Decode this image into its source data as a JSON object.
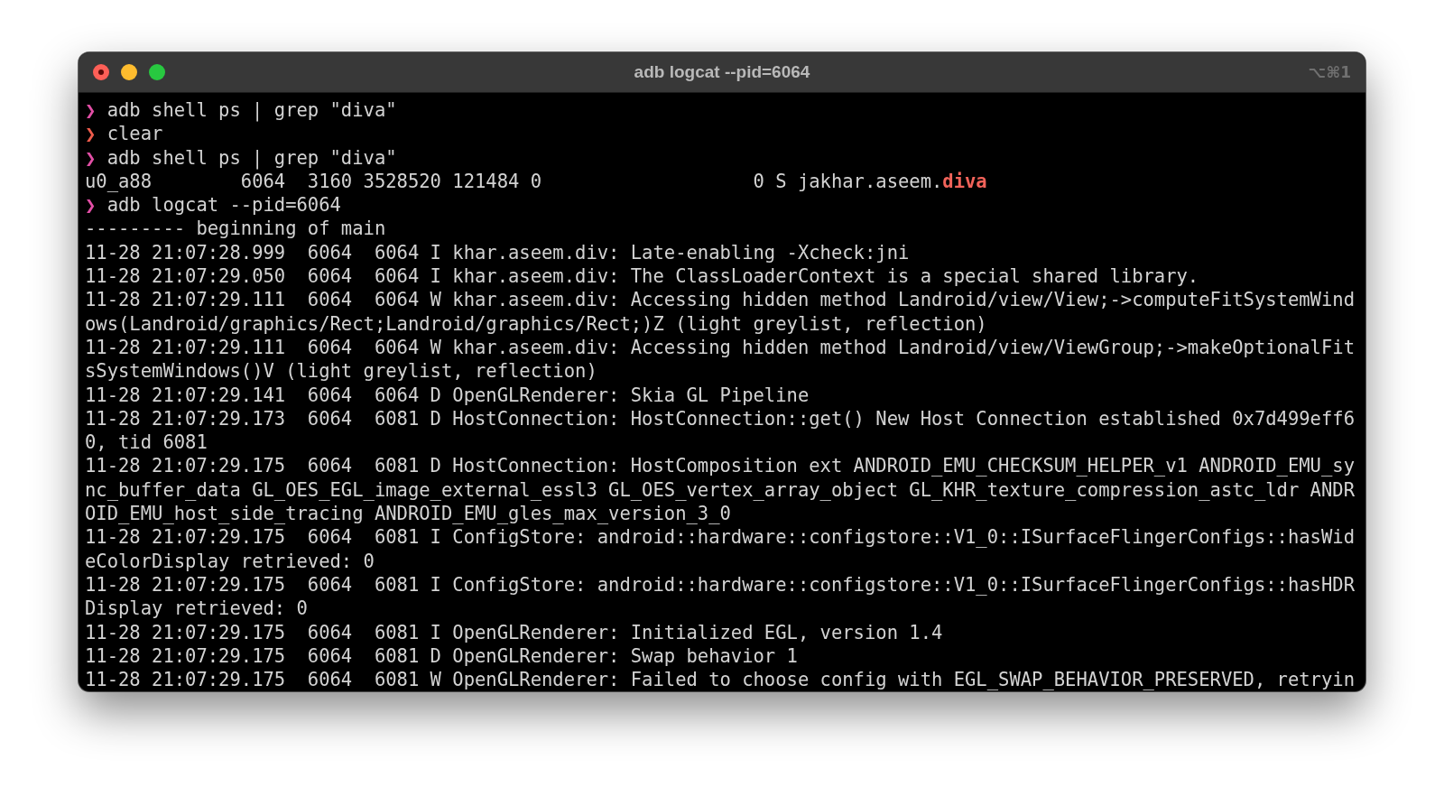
{
  "window": {
    "title": "adb logcat --pid=6064",
    "shortcut": "⌥⌘1"
  },
  "lines": [
    {
      "kind": "prompt",
      "symbol": "❯",
      "color": "#e24fa6",
      "text": "adb shell ps | grep \"diva\""
    },
    {
      "kind": "prompt",
      "symbol": "❯",
      "color": "#ee5c4c",
      "text": "clear"
    },
    {
      "kind": "prompt",
      "symbol": "❯",
      "color": "#e24fa6",
      "text": "adb shell ps | grep \"diva\""
    },
    {
      "kind": "match",
      "text": "u0_a88        6064  3160 3528520 121484 0                   0 S jakhar.aseem.",
      "match": "diva"
    },
    {
      "kind": "prompt",
      "symbol": "❯",
      "color": "#e24fa6",
      "text": "adb logcat --pid=6064"
    },
    {
      "kind": "output",
      "text": "--------- beginning of main"
    },
    {
      "kind": "output",
      "text": "11-28 21:07:28.999  6064  6064 I khar.aseem.div: Late-enabling -Xcheck:jni"
    },
    {
      "kind": "output",
      "text": "11-28 21:07:29.050  6064  6064 I khar.aseem.div: The ClassLoaderContext is a special shared library."
    },
    {
      "kind": "output",
      "text": "11-28 21:07:29.111  6064  6064 W khar.aseem.div: Accessing hidden method Landroid/view/View;->computeFitSystemWind"
    },
    {
      "kind": "output",
      "text": "ows(Landroid/graphics/Rect;Landroid/graphics/Rect;)Z (light greylist, reflection)"
    },
    {
      "kind": "output",
      "text": "11-28 21:07:29.111  6064  6064 W khar.aseem.div: Accessing hidden method Landroid/view/ViewGroup;->makeOptionalFit"
    },
    {
      "kind": "output",
      "text": "sSystemWindows()V (light greylist, reflection)"
    },
    {
      "kind": "output",
      "text": "11-28 21:07:29.141  6064  6064 D OpenGLRenderer: Skia GL Pipeline"
    },
    {
      "kind": "output",
      "text": "11-28 21:07:29.173  6064  6081 D HostConnection: HostConnection::get() New Host Connection established 0x7d499eff6"
    },
    {
      "kind": "output",
      "text": "0, tid 6081"
    },
    {
      "kind": "output",
      "text": "11-28 21:07:29.175  6064  6081 D HostConnection: HostComposition ext ANDROID_EMU_CHECKSUM_HELPER_v1 ANDROID_EMU_sy"
    },
    {
      "kind": "output",
      "text": "nc_buffer_data GL_OES_EGL_image_external_essl3 GL_OES_vertex_array_object GL_KHR_texture_compression_astc_ldr ANDR"
    },
    {
      "kind": "output",
      "text": "OID_EMU_host_side_tracing ANDROID_EMU_gles_max_version_3_0"
    },
    {
      "kind": "output",
      "text": "11-28 21:07:29.175  6064  6081 I ConfigStore: android::hardware::configstore::V1_0::ISurfaceFlingerConfigs::hasWid"
    },
    {
      "kind": "output",
      "text": "eColorDisplay retrieved: 0"
    },
    {
      "kind": "output",
      "text": "11-28 21:07:29.175  6064  6081 I ConfigStore: android::hardware::configstore::V1_0::ISurfaceFlingerConfigs::hasHDR"
    },
    {
      "kind": "output",
      "text": "Display retrieved: 0"
    },
    {
      "kind": "output",
      "text": "11-28 21:07:29.175  6064  6081 I OpenGLRenderer: Initialized EGL, version 1.4"
    },
    {
      "kind": "output",
      "text": "11-28 21:07:29.175  6064  6081 D OpenGLRenderer: Swap behavior 1"
    },
    {
      "kind": "output",
      "text": "11-28 21:07:29.175  6064  6081 W OpenGLRenderer: Failed to choose config with EGL_SWAP_BEHAVIOR_PRESERVED, retryin"
    }
  ]
}
